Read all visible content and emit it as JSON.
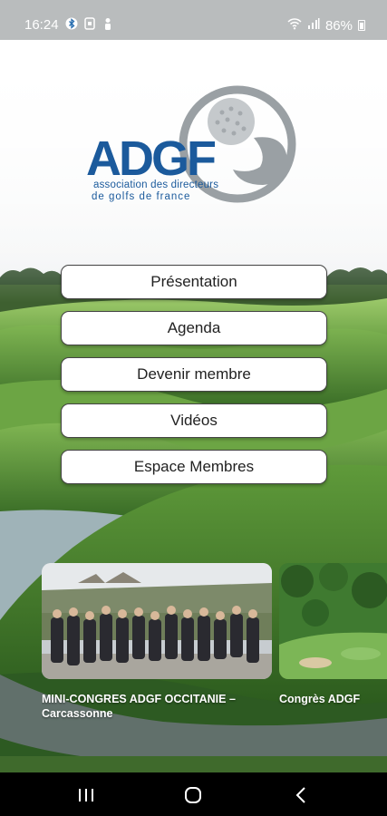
{
  "status_bar": {
    "time": "16:24",
    "battery": "86%",
    "icons": [
      "bluetooth-icon",
      "sim-icon",
      "person-icon",
      "wifi-icon",
      "signal-icon",
      "battery-icon"
    ]
  },
  "logo": {
    "brand": "ADGF",
    "line1": "association des directeurs",
    "line2": "de golfs de france",
    "color": "#1b5a9c"
  },
  "menu": {
    "items": [
      {
        "label": "Présentation"
      },
      {
        "label": "Agenda"
      },
      {
        "label": "Devenir membre"
      },
      {
        "label": "Vidéos"
      },
      {
        "label": "Espace Membres"
      }
    ]
  },
  "news": {
    "items": [
      {
        "caption": "MINI-CONGRES ADGF OCCITANIE – Carcassonne"
      },
      {
        "caption": "Congrès ADGF"
      }
    ]
  },
  "nav_bar": {
    "icons": [
      "recent-apps-icon",
      "home-icon",
      "back-icon"
    ]
  }
}
